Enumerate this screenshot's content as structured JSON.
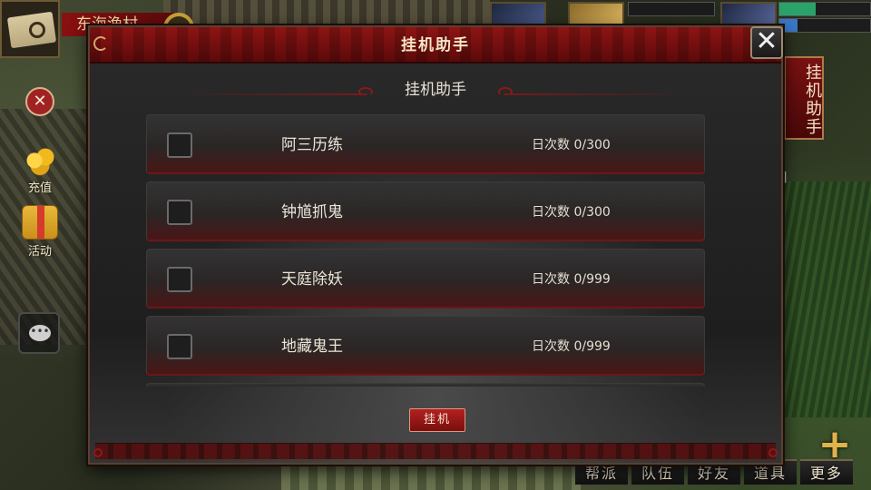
{
  "hud": {
    "location_name": "东海渔村",
    "close_glyph": "✕",
    "recharge_label": "充值",
    "activity_label": "活动",
    "chat_glyph": "•••",
    "right_tab_label": "挂机助手",
    "right_bracket": "]",
    "bottom_menu": [
      "帮派",
      "队伍",
      "好友",
      "道具",
      "更多"
    ],
    "plus_glyph": "+"
  },
  "modal": {
    "title": "挂机助手",
    "close_glyph": "✕",
    "subtitle": "挂机助手",
    "tasks": [
      {
        "name": "阿三历练",
        "count": "日次数 0/300",
        "checked": false
      },
      {
        "name": "钟馗抓鬼",
        "count": "日次数 0/300",
        "checked": false
      },
      {
        "name": "天庭除妖",
        "count": "日次数 0/999",
        "checked": false
      },
      {
        "name": "地藏鬼王",
        "count": "日次数 0/999",
        "checked": false
      }
    ],
    "start_button": "挂机"
  },
  "colors": {
    "accent_red": "#8e1414",
    "button_red": "#b32020",
    "gold": "#c9a23c"
  }
}
